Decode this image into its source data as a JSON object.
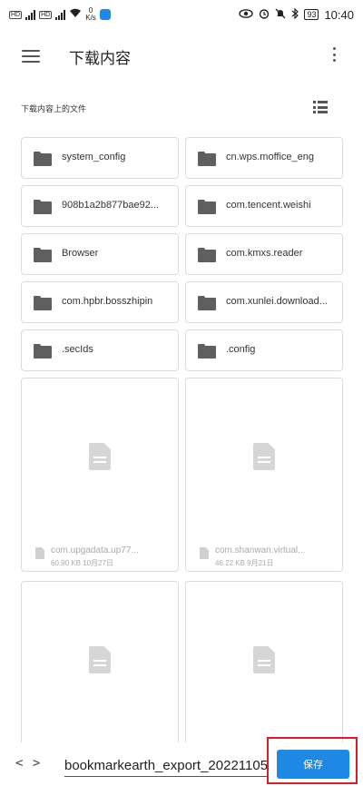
{
  "status_bar": {
    "left_icons": [
      "hd-icon",
      "signal-icon",
      "hd-icon",
      "signal-icon",
      "wifi-icon"
    ],
    "net_speed_value": "0",
    "net_speed_unit": "K/s",
    "right_icons": [
      "eye-icon",
      "alarm-icon",
      "mute-icon",
      "bluetooth-icon"
    ],
    "battery": "93",
    "time": "10:40"
  },
  "app_bar": {
    "title": "下载内容"
  },
  "section": {
    "title": "下载内容上的文件"
  },
  "folders": [
    {
      "name": "system_config"
    },
    {
      "name": "cn.wps.moffice_eng"
    },
    {
      "name": "908b1a2b877bae92..."
    },
    {
      "name": "com.tencent.weishi"
    },
    {
      "name": "Browser"
    },
    {
      "name": "com.kmxs.reader"
    },
    {
      "name": "com.hpbr.bosszhipin"
    },
    {
      "name": "com.xunlei.download..."
    },
    {
      "name": ".secIds"
    },
    {
      "name": ".config"
    }
  ],
  "files": [
    {
      "name": "com.upgadata.up77...",
      "meta": "60.90 KB 10月27日"
    },
    {
      "name": "com.shanwan.virtual...",
      "meta": "46.22 KB 9月21日"
    },
    {
      "name": "",
      "meta": ""
    },
    {
      "name": "",
      "meta": ""
    }
  ],
  "bottom_bar": {
    "code_icon_label": "< >",
    "filename_value": "bookmarkearth_export_20221105.",
    "save_label": "保存"
  },
  "colors": {
    "accent": "#1e88e5",
    "highlight": "#d9202a",
    "folder_icon": "#5f5f5f",
    "tile_border": "#dcdcdc"
  }
}
